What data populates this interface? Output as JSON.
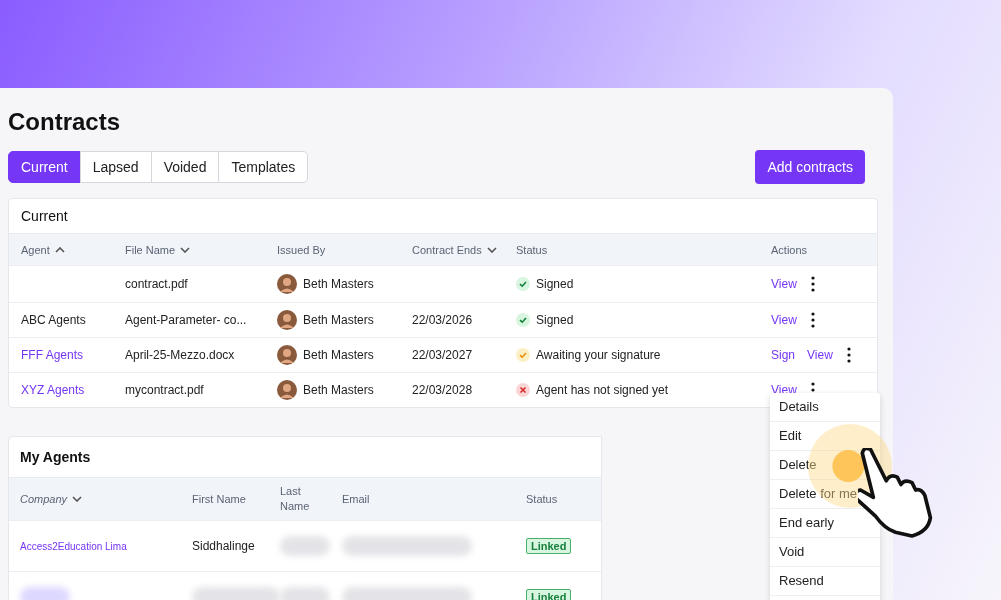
{
  "page": {
    "title": "Contracts"
  },
  "tabs": [
    {
      "label": "Current",
      "selected": true
    },
    {
      "label": "Lapsed",
      "selected": false
    },
    {
      "label": "Voided",
      "selected": false
    },
    {
      "label": "Templates",
      "selected": false
    }
  ],
  "add_button": "Add contracts",
  "contracts": {
    "title": "Current",
    "columns": [
      {
        "label": "Agent",
        "sorted": true,
        "descending": false
      },
      {
        "label": "File Name",
        "sorted": true,
        "descending": true
      },
      {
        "label": "Issued By",
        "sorted": false
      },
      {
        "label": "Contract Ends",
        "sorted": true,
        "descending": true
      },
      {
        "label": "Status",
        "sorted": false
      },
      {
        "label": "Actions",
        "sorted": false
      }
    ],
    "rows": [
      {
        "agent": "",
        "file": "contract.pdf",
        "issued_by": "Beth Masters",
        "ends": "",
        "status": {
          "kind": "signed",
          "text": "Signed"
        },
        "actions": [
          "View"
        ]
      },
      {
        "agent": "ABC Agents",
        "agent_link": false,
        "file": "Agent-Parameter- co...",
        "issued_by": "Beth Masters",
        "ends": "22/03/2026",
        "status": {
          "kind": "signed",
          "text": "Signed"
        },
        "actions": [
          "View"
        ]
      },
      {
        "agent": "FFF Agents",
        "agent_link": true,
        "file": "April-25-Mezzo.docx",
        "issued_by": "Beth Masters",
        "ends": "22/03/2027",
        "status": {
          "kind": "awaiting",
          "text": "Awaiting your signature"
        },
        "actions": [
          "Sign",
          "View"
        ]
      },
      {
        "agent": "XYZ Agents",
        "agent_link": true,
        "file": "mycontract.pdf",
        "issued_by": "Beth Masters",
        "ends": "22/03/2028",
        "status": {
          "kind": "rejected",
          "text": "Agent has not signed yet"
        },
        "actions": [
          "View"
        ]
      }
    ]
  },
  "menu": {
    "items": [
      "Details",
      "Edit",
      "Delete",
      "Delete for me",
      "End early",
      "Void",
      "Resend"
    ]
  },
  "agents": {
    "title": "My Agents",
    "columns": [
      {
        "label": "Company",
        "sorted": true,
        "descending": true
      },
      {
        "label": "First Name",
        "sorted": false
      },
      {
        "label": "Last Name",
        "sorted": false
      },
      {
        "label": "Email",
        "sorted": false
      },
      {
        "label": "Status",
        "sorted": false
      }
    ],
    "rows": [
      {
        "company": {
          "text": "Access2Education Lima"
        },
        "first_name": {
          "text": "Siddhalinge"
        },
        "last_name": {
          "redacted": true
        },
        "email": {
          "redacted": true
        },
        "status": "Linked"
      },
      {
        "company": {
          "redacted": true
        },
        "first_name": {
          "redacted": true
        },
        "last_name": {
          "redacted": true
        },
        "email": {
          "redacted": true
        },
        "status": "Linked"
      }
    ]
  }
}
